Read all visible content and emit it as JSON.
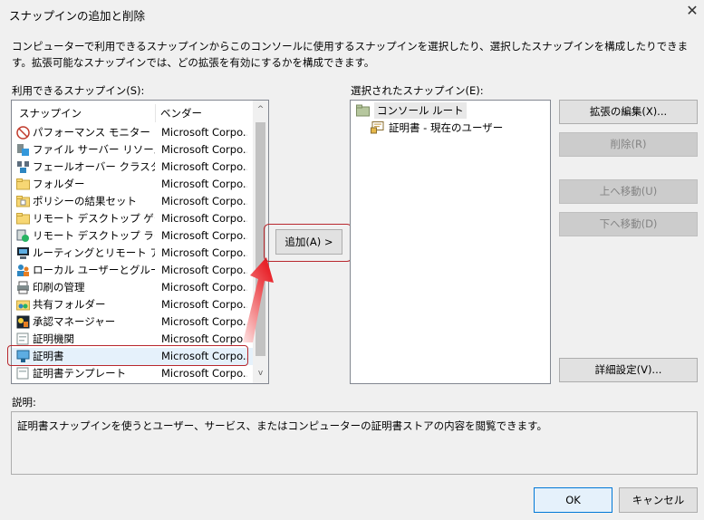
{
  "window": {
    "title": "スナップインの追加と削除",
    "close_glyph": "✕"
  },
  "intro": "コンピューターで利用できるスナップインからこのコンソールに使用するスナップインを選択したり、選択したスナップインを構成したりできます。拡張可能なスナップインでは、どの拡張を有効にするかを構成できます。",
  "available": {
    "label": "利用できるスナップイン(S):",
    "headers": [
      "スナップイン",
      "ベンダー"
    ],
    "scroll_up": "^",
    "scroll_down": "v",
    "items": [
      {
        "name": "パフォーマンス モニター",
        "vendor": "Microsoft Corpo...",
        "icon": "performance-monitor-icon"
      },
      {
        "name": "ファイル サーバー リソース マネ...",
        "vendor": "Microsoft Corpo...",
        "icon": "file-server-icon"
      },
      {
        "name": "フェールオーバー クラスター マ...",
        "vendor": "Microsoft Corpo...",
        "icon": "cluster-icon"
      },
      {
        "name": "フォルダー",
        "vendor": "Microsoft Corpo...",
        "icon": "folder-icon"
      },
      {
        "name": "ポリシーの結果セット",
        "vendor": "Microsoft Corpo...",
        "icon": "policy-icon"
      },
      {
        "name": "リモート デスクトップ ゲートウ...",
        "vendor": "Microsoft Corpo...",
        "icon": "folder-icon"
      },
      {
        "name": "リモート デスクトップ ライセン...",
        "vendor": "Microsoft Corpo...",
        "icon": "license-icon"
      },
      {
        "name": "ルーティングとリモート アクセス",
        "vendor": "Microsoft Corpo...",
        "icon": "routing-icon"
      },
      {
        "name": "ローカル ユーザーとグループ",
        "vendor": "Microsoft Corpo...",
        "icon": "users-icon"
      },
      {
        "name": "印刷の管理",
        "vendor": "Microsoft Corpo...",
        "icon": "printer-icon"
      },
      {
        "name": "共有フォルダー",
        "vendor": "Microsoft Corpo...",
        "icon": "shared-folder-icon"
      },
      {
        "name": "承認マネージャー",
        "vendor": "Microsoft Corpo...",
        "icon": "authorization-icon"
      },
      {
        "name": "証明機関",
        "vendor": "Microsoft Corpo...",
        "icon": "certificate-authority-icon"
      },
      {
        "name": "証明書",
        "vendor": "Microsoft Corpo...",
        "icon": "certificate-icon",
        "selected": true
      },
      {
        "name": "証明書テンプレート",
        "vendor": "Microsoft Corpo...",
        "icon": "certificate-template-icon"
      }
    ]
  },
  "add_button": "追加(A) >",
  "selected": {
    "label": "選択されたスナップイン(E):",
    "root": "コンソール ルート",
    "child": "証明書 - 現在のユーザー"
  },
  "side_buttons": {
    "edit_extensions": "拡張の編集(X)...",
    "remove": "削除(R)",
    "move_up": "上へ移動(U)",
    "move_down": "下へ移動(D)",
    "advanced": "詳細設定(V)..."
  },
  "description": {
    "label": "説明:",
    "text": "証明書スナップインを使うとユーザー、サービス、またはコンピューターの証明書ストアの内容を閲覧できます。"
  },
  "footer": {
    "ok": "OK",
    "cancel": "キャンセル"
  },
  "colors": {
    "highlight_frame": "#b8282e",
    "arrow_red": "#e8232a",
    "default_button_border": "#0078d7"
  }
}
